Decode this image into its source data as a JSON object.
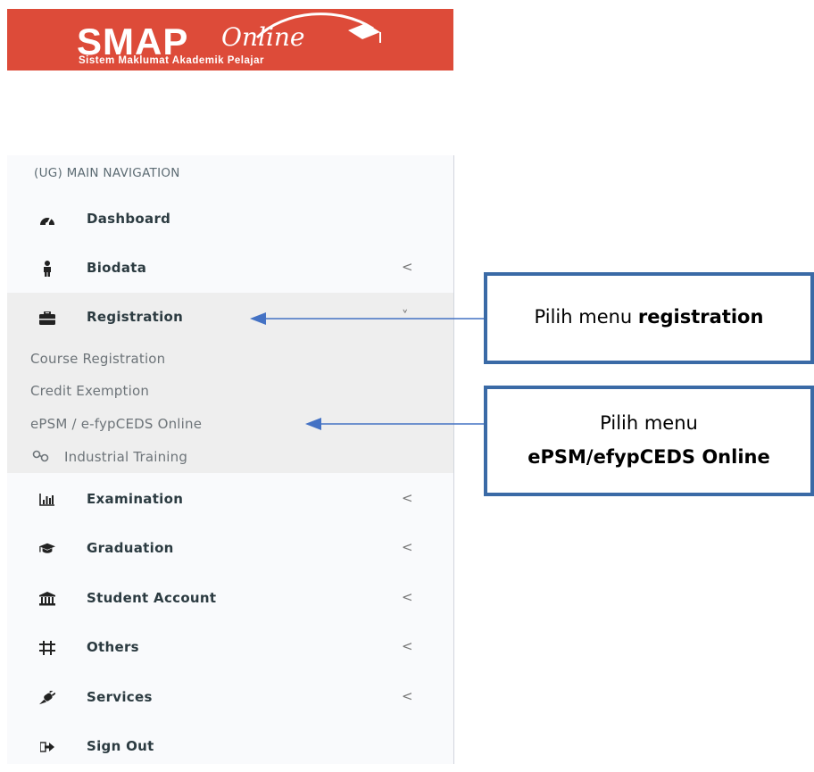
{
  "logo": {
    "main": "SMAP",
    "script": "Online",
    "subtitle": "Sistem Maklumat Akademik Pelajar"
  },
  "nav": {
    "header": "(UG) MAIN NAVIGATION",
    "items": [
      {
        "label": "Dashboard",
        "icon": "dashboard-icon"
      },
      {
        "label": "Biodata",
        "icon": "person-icon",
        "chevron": "<"
      },
      {
        "label": "Registration",
        "icon": "briefcase-icon",
        "chevron": "˅"
      },
      {
        "label": "Examination",
        "icon": "bar-chart-icon",
        "chevron": "<"
      },
      {
        "label": "Graduation",
        "icon": "graduation-cap-icon",
        "chevron": "<"
      },
      {
        "label": "Student Account",
        "icon": "bank-icon",
        "chevron": "<"
      },
      {
        "label": "Others",
        "icon": "sliders-icon",
        "chevron": "<"
      },
      {
        "label": "Services",
        "icon": "plug-icon",
        "chevron": "<"
      },
      {
        "label": "Sign Out",
        "icon": "sign-out-icon"
      }
    ],
    "registration_sub": [
      {
        "label": "Course Registration"
      },
      {
        "label": "Credit Exemption"
      },
      {
        "label": "ePSM / e-fypCEDS Online"
      },
      {
        "label": "Industrial Training",
        "icon": "link-icon"
      }
    ]
  },
  "callouts": {
    "registration": {
      "prefix": "Pilih menu ",
      "bold": "registration"
    },
    "epsm": {
      "line1": "Pilih menu",
      "line2": "ePSM/efypCEDS Online"
    }
  },
  "colors": {
    "banner": "#dd4b39",
    "callout_border": "#3a6aa6",
    "arrow": "#4472c4",
    "sidebar_bg": "#f9fafc",
    "active_bg": "#eeeeee"
  }
}
